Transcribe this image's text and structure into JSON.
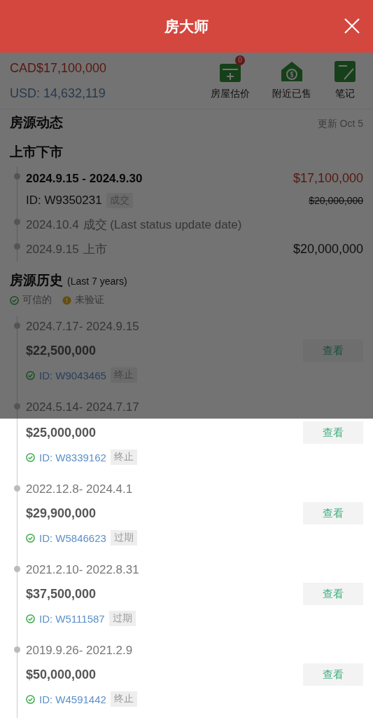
{
  "header": {
    "title": "房大师"
  },
  "price_bar": {
    "cad": "CAD$17,100,000",
    "usd": "USD: 14,632,119",
    "actions": [
      {
        "kind": "estimate",
        "label": "房屋估价",
        "badge": "0"
      },
      {
        "kind": "sold",
        "label": "附近已售"
      },
      {
        "kind": "notes",
        "label": "笔记"
      }
    ]
  },
  "activity": {
    "title": "房源动态",
    "updated": "更新 Oct 5"
  },
  "listing_status": {
    "title": "上市下市",
    "current": {
      "dates": "2024.9.15 - 2024.9.30",
      "price": "$17,100,000",
      "id": "ID: W9350231",
      "tag": "成交",
      "original_price": "$20,000,000"
    },
    "events": [
      {
        "date": "2024.10.4",
        "text": "成交 (Last status update date)"
      },
      {
        "date": "2024.9.15",
        "text": "上市",
        "price": "$20,000,000"
      }
    ]
  },
  "history": {
    "title": "房源历史",
    "note": "(Last 7 years)",
    "legend": [
      {
        "kind": "verified",
        "label": "可信的"
      },
      {
        "kind": "unverified",
        "label": "未验证"
      }
    ],
    "entries": [
      {
        "dates": "2024.7.17- 2024.9.15",
        "price": "$22,500,000",
        "verified": true,
        "id": "ID: W9043465",
        "tag": "终止",
        "button": "查看"
      },
      {
        "dates": "2024.5.14- 2024.7.17",
        "price": "$25,000,000",
        "verified": true,
        "id": "ID: W8339162",
        "tag": "终止",
        "button": "查看"
      },
      {
        "dates": "2022.12.8- 2024.4.1",
        "price": "$29,900,000",
        "verified": true,
        "id": "ID: W5846623",
        "tag": "过期",
        "button": "查看"
      },
      {
        "dates": "2021.2.10- 2022.8.31",
        "price": "$37,500,000",
        "verified": true,
        "id": "ID: W5111587",
        "tag": "过期",
        "button": "查看"
      },
      {
        "dates": "2019.9.26- 2021.2.9",
        "price": "$50,000,000",
        "verified": true,
        "id": "ID: W4591442",
        "tag": "终止",
        "button": "查看"
      }
    ]
  }
}
